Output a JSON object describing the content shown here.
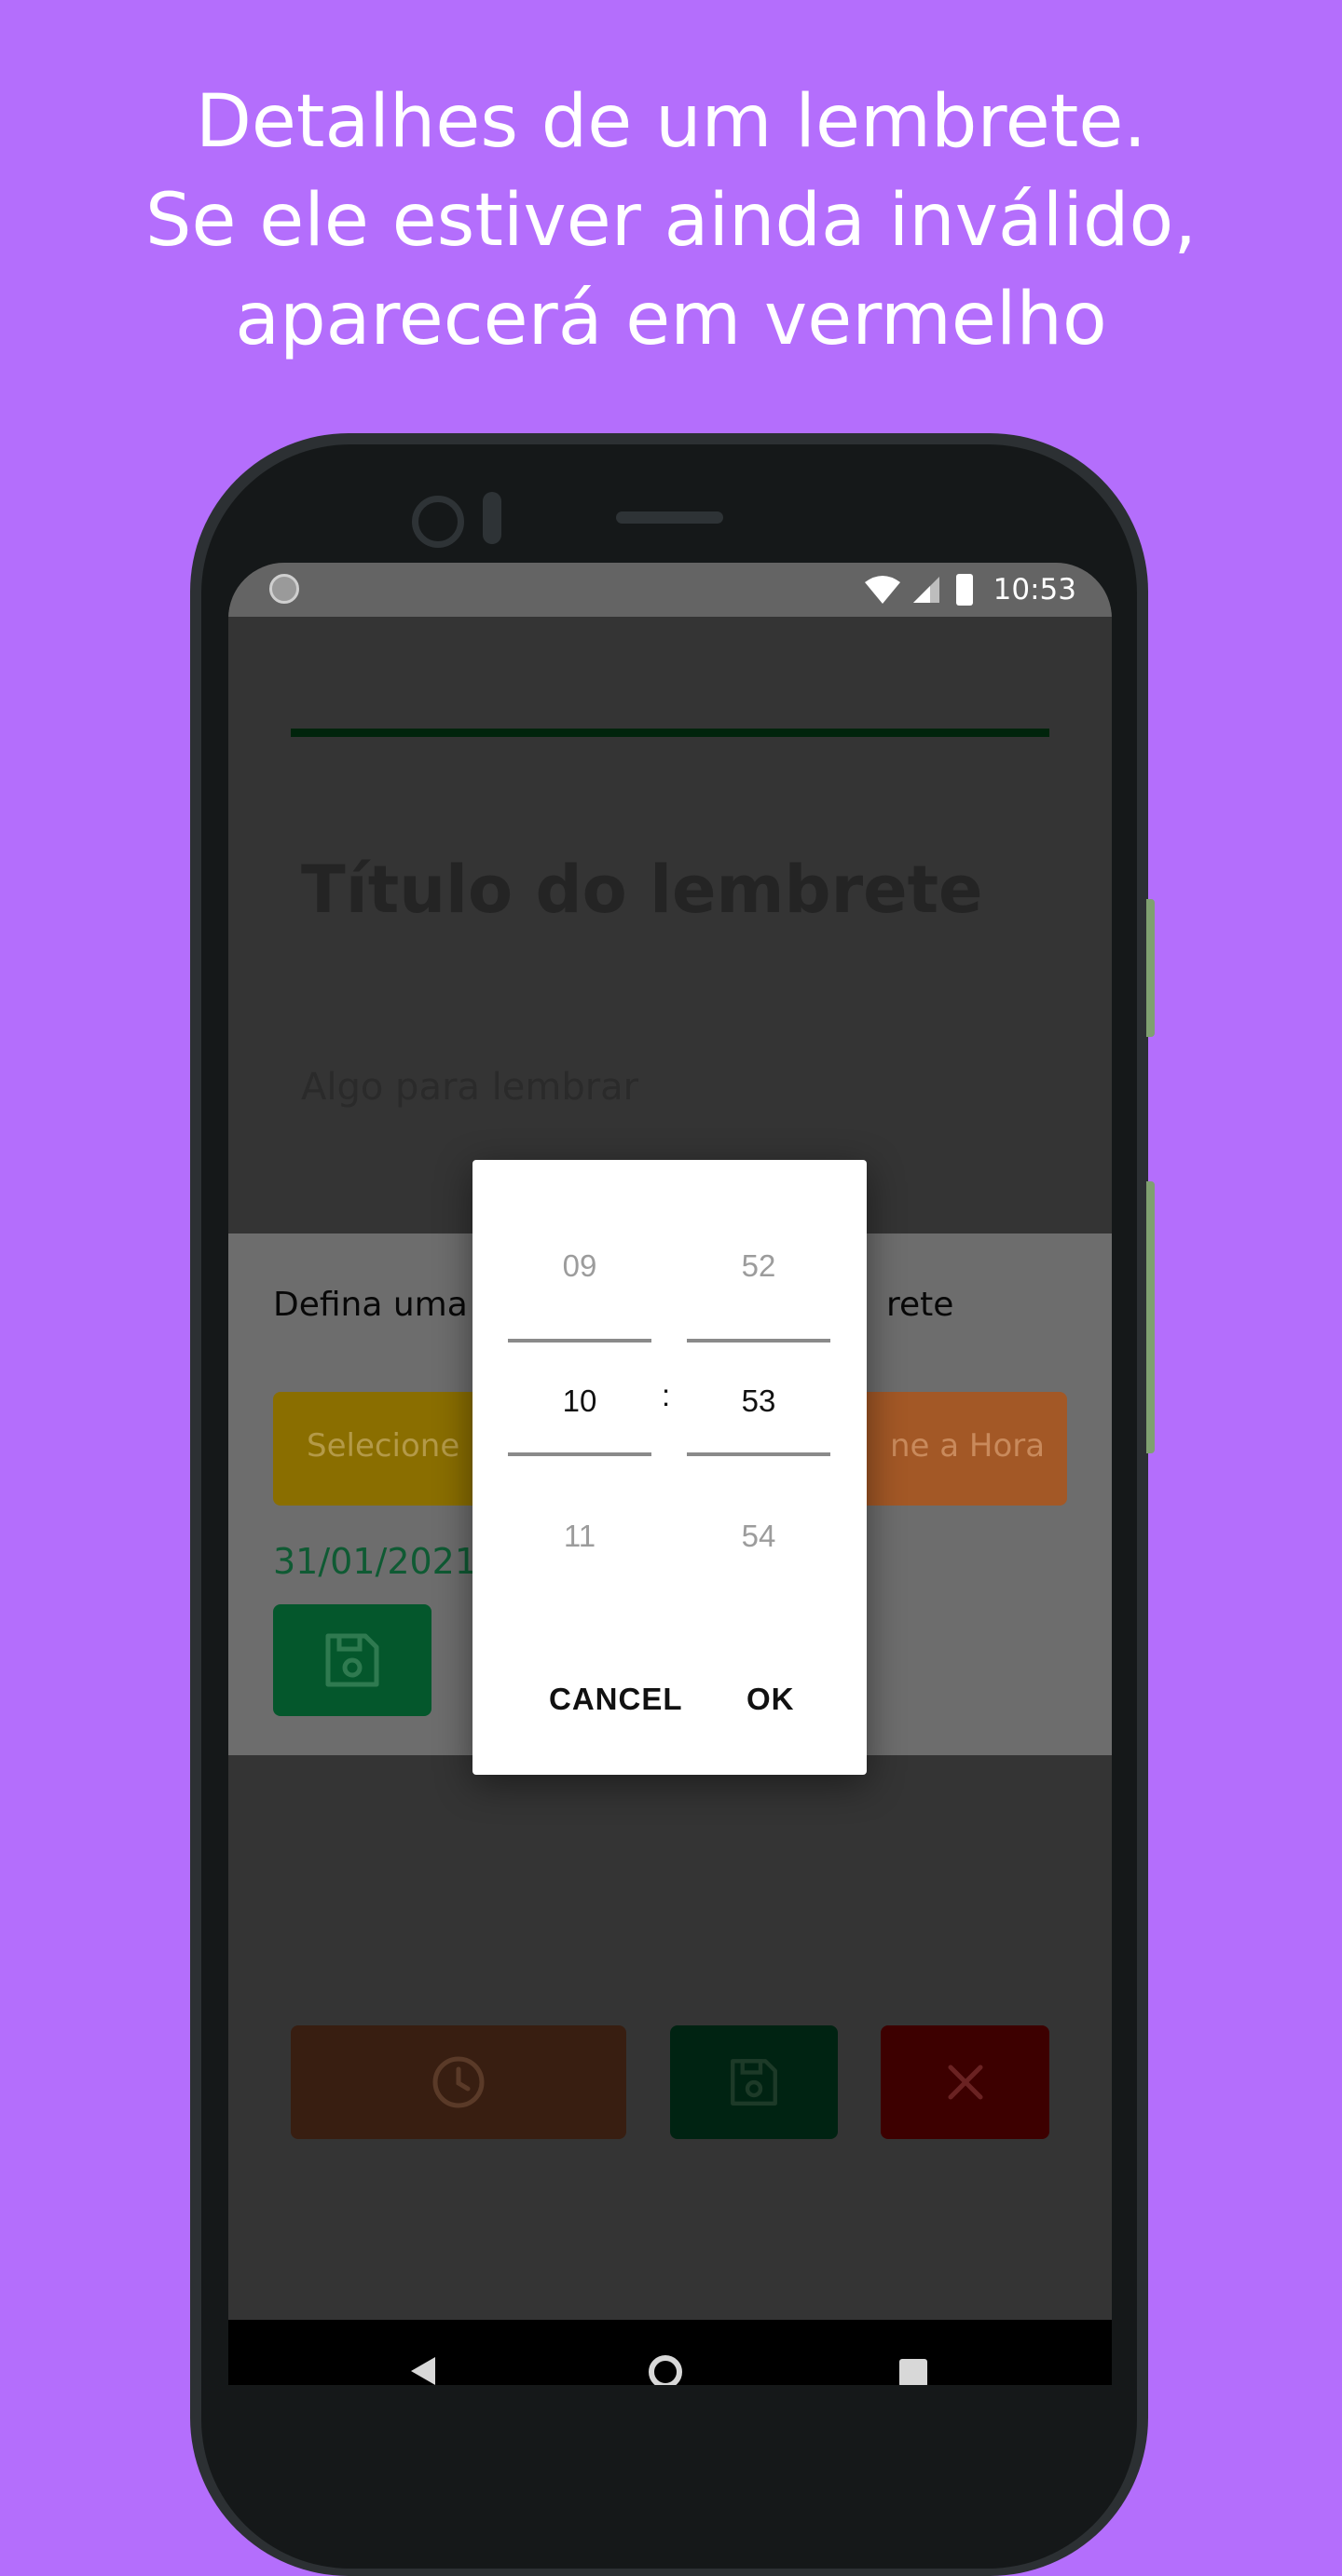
{
  "headline": {
    "line1": "Detalhes de um lembrete.",
    "line2": "Se ele estiver ainda inválido,",
    "line3": "aparecerá em vermelho"
  },
  "status_bar": {
    "time": "10:53",
    "icons": [
      "wifi-icon",
      "signal-icon",
      "battery-icon"
    ]
  },
  "reminder": {
    "title_placeholder": "Título do lembrete",
    "body_placeholder": "Algo para lembrar"
  },
  "sheet": {
    "text_left": "Defina uma",
    "text_right": "rete",
    "date_button_label": "Selecione u",
    "time_button_label": "ne a Hora",
    "selected_date": "31/01/2021"
  },
  "time_picker": {
    "hours": [
      "09",
      "10",
      "11"
    ],
    "minutes": [
      "52",
      "53",
      "54"
    ],
    "separator": ":",
    "cancel_label": "CANCEL",
    "ok_label": "OK"
  },
  "colors": {
    "background": "#b46efc",
    "save_green": "#04572c",
    "date_yellow": "#8a6e00",
    "time_orange": "#a35826"
  }
}
